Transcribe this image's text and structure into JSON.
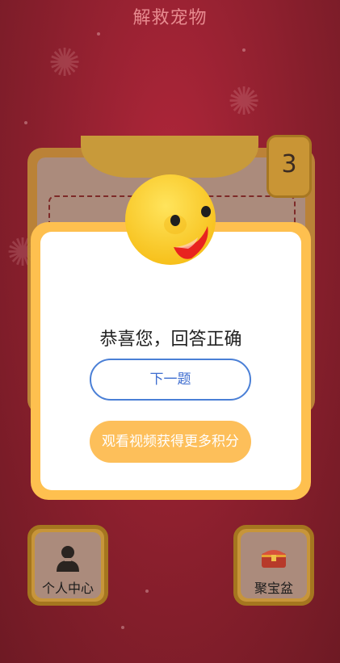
{
  "header": {
    "title": "解救宠物"
  },
  "level": {
    "number": "3"
  },
  "modal": {
    "message": "恭喜您，回答正确",
    "next_label": "下一题",
    "video_label": "观看视频获得更多积分"
  },
  "bottom": {
    "left_label": "个人中心",
    "right_label": "聚宝盆"
  },
  "colors": {
    "background": "#8a1f2d",
    "modal_frame": "#fec04f",
    "next_border": "#4a7fd6",
    "video_button": "#fdbf5a",
    "smiley": "#fed53a"
  },
  "icons": {
    "left": "person-icon",
    "right": "treasure-chest-icon",
    "face": "smiley-face-icon"
  }
}
